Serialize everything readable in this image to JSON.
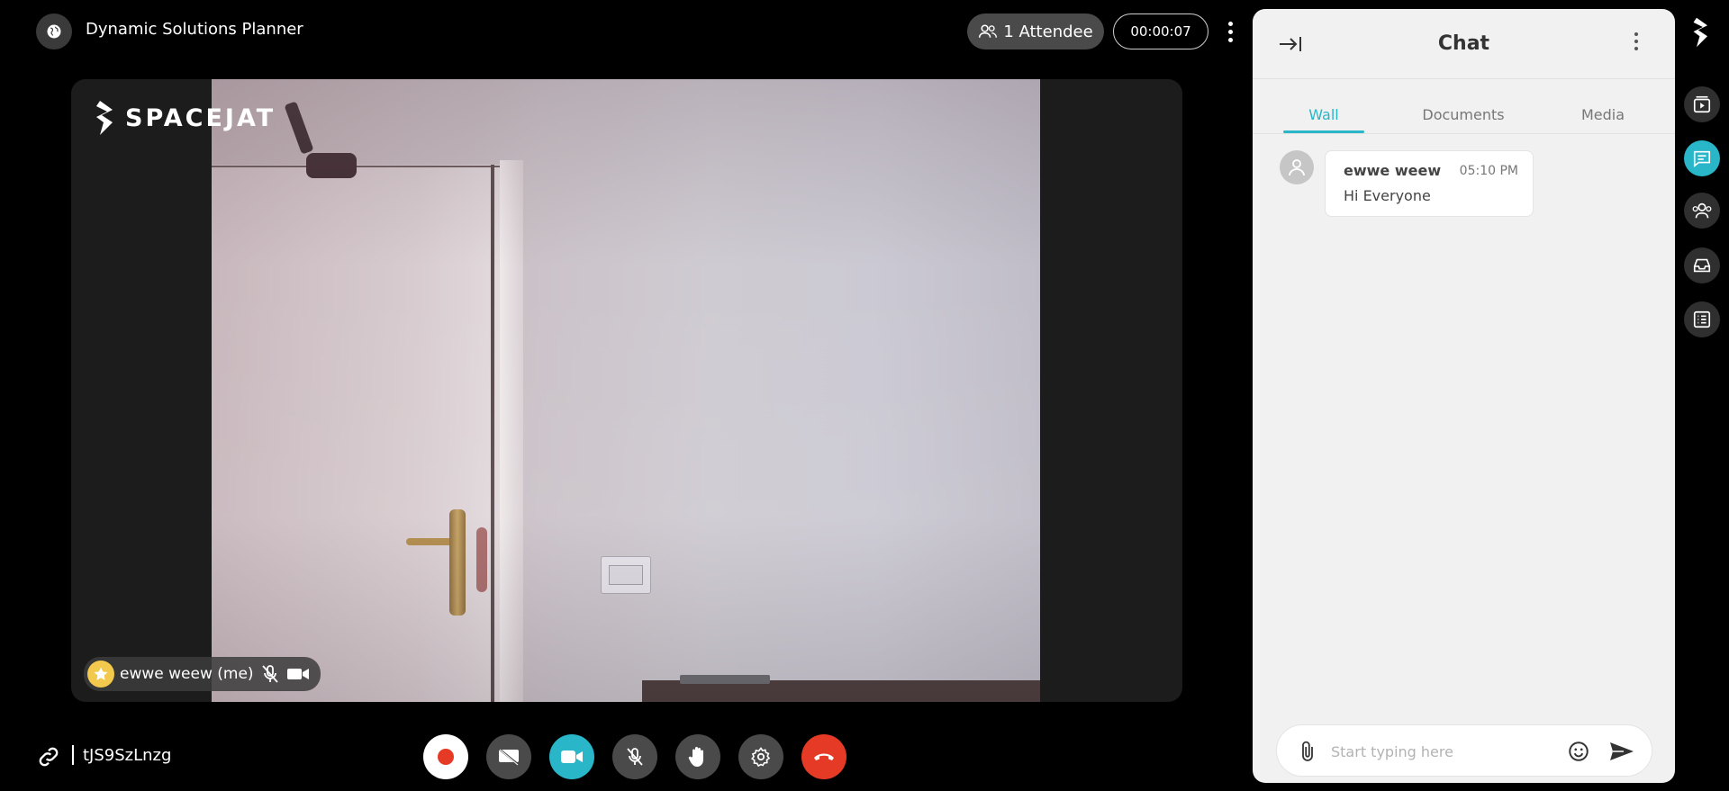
{
  "header": {
    "meeting_title": "Dynamic Solutions Planner",
    "attendees_label": "1 Attendee",
    "timer": "00:00:07"
  },
  "video": {
    "brand": "SPACEJAT",
    "participant_name": "ewwe weew (me)"
  },
  "footer": {
    "meeting_code": "tJS9SzLnzg"
  },
  "chat": {
    "title": "Chat",
    "tabs": [
      {
        "label": "Wall",
        "active": true
      },
      {
        "label": "Documents",
        "active": false
      },
      {
        "label": "Media",
        "active": false
      }
    ],
    "messages": [
      {
        "author": "ewwe weew",
        "time": "05:10 PM",
        "text": "Hi Everyone"
      }
    ],
    "composer_placeholder": "Start typing here"
  },
  "colors": {
    "accent": "#29b6c9",
    "end_call": "#e53a26",
    "star": "#f2c94c"
  },
  "icons": {
    "top_left": "globe-icon",
    "attendees": "people-icon",
    "controls": [
      "record-icon",
      "screen-share-off-icon",
      "video-camera-icon",
      "mic-off-icon",
      "raise-hand-icon",
      "settings-icon",
      "end-call-icon"
    ],
    "rail": [
      "logo-icon",
      "playlist-icon",
      "chat-icon",
      "participants-icon",
      "inbox-icon",
      "list-icon"
    ]
  }
}
